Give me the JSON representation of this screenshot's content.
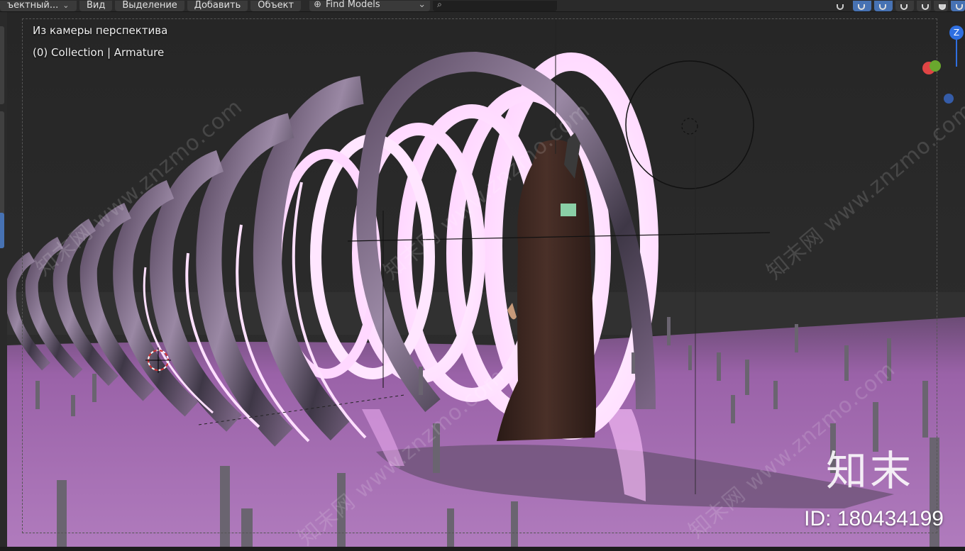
{
  "header": {
    "mode_label": "ъектный...",
    "menu_view": "Вид",
    "menu_select": "Выделение",
    "menu_add": "Добавить",
    "menu_object": "Объект",
    "find_models": "Find Models"
  },
  "viewport": {
    "view_name": "Из камеры перспектива",
    "collection_info": "(0) Collection | Armature"
  },
  "gizmo": {
    "z_label": "Z"
  },
  "watermark": {
    "site": "www.znzmo.com",
    "brand_cn": "知末网",
    "logo": "知末",
    "id_text": "ID: 180434199"
  },
  "colors": {
    "accent": "#4772b3",
    "floor": "#a465b0",
    "ring_glow": "#ffe6ff"
  }
}
